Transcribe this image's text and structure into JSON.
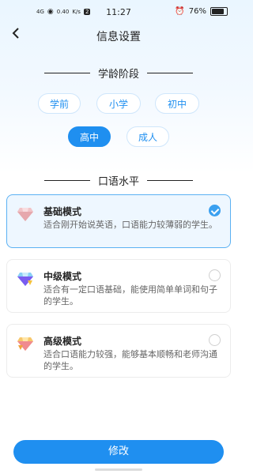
{
  "status_bar": {
    "network": "4G",
    "speed_value": "0.40",
    "speed_unit": "K/s",
    "sim": "2",
    "time": "11:27",
    "battery": "76%",
    "battery_level": 0.76
  },
  "header": {
    "back_icon": "back-arrow-icon",
    "title": "信息设置"
  },
  "age_section": {
    "heading": "学龄阶段",
    "options": [
      "学前",
      "小学",
      "初中",
      "高中",
      "成人"
    ],
    "selected": "高中"
  },
  "level_section": {
    "heading": "口语水平",
    "cards": [
      {
        "icon": "diamond-pink-icon",
        "name": "基础模式",
        "desc": "适合刚开始说英语，口语能力较薄弱的学生。",
        "selected": true
      },
      {
        "icon": "diamond-blue-icon",
        "name": "中级模式",
        "desc": "适合有一定口语基础，能使用简单单词和句子的学生。",
        "selected": false
      },
      {
        "icon": "diamond-gold-icon",
        "name": "高级模式",
        "desc": "适合口语能力较强，能够基本顺畅和老师沟通的学生。",
        "selected": false
      }
    ]
  },
  "footer": {
    "button_label": "修改"
  },
  "colors": {
    "accent": "#1f8ff0",
    "selected_card_bg": "#eef7ff",
    "selected_card_border": "#5bb1f3"
  }
}
